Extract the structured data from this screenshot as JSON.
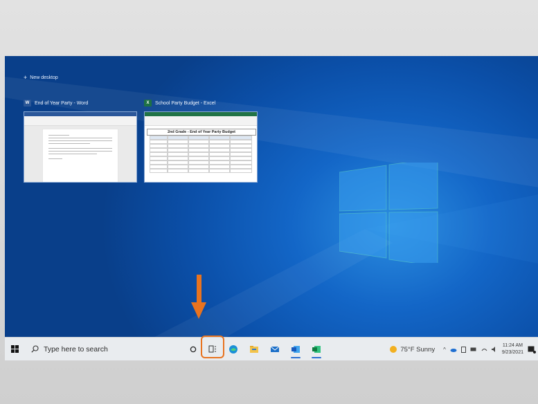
{
  "desktop": {
    "new_desktop_label": "New desktop",
    "windows": [
      {
        "title": "End of Year Party - Word",
        "app": "word"
      },
      {
        "title": "School Party Budget - Excel",
        "app": "excel",
        "sheet_heading": "2nd Grade - End of Year Party Budget"
      }
    ]
  },
  "taskbar": {
    "search_placeholder": "Type here to search",
    "pinned": [
      "cortana-icon",
      "task-view-icon",
      "edge-icon",
      "file-explorer-icon",
      "mail-icon",
      "word-icon",
      "excel-icon"
    ],
    "highlighted": "task-view-icon"
  },
  "tray": {
    "weather": "75°F  Sunny",
    "time": "11:24 AM",
    "date": "9/23/2021"
  },
  "colors": {
    "highlight": "#e8731f",
    "arrow": "#e8731f",
    "desktop": "#1366c7"
  }
}
